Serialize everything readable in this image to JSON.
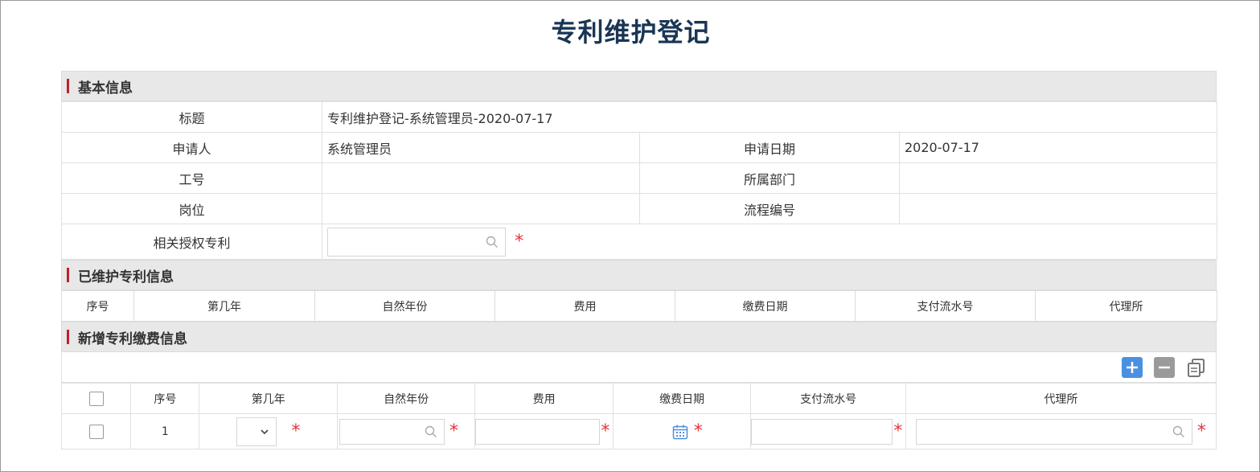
{
  "title": "专利维护登记",
  "sections": {
    "basic": "基本信息",
    "maintained": "已维护专利信息",
    "new_payment": "新增专利缴费信息"
  },
  "basic_info": {
    "title_label": "标题",
    "title_value": "专利维护登记-系统管理员-2020-07-17",
    "applicant_label": "申请人",
    "applicant_value": "系统管理员",
    "apply_date_label": "申请日期",
    "apply_date_value": "2020-07-17",
    "emp_no_label": "工号",
    "emp_no_value": "",
    "department_label": "所属部门",
    "department_value": "",
    "position_label": "岗位",
    "position_value": "",
    "flow_no_label": "流程编号",
    "flow_no_value": "",
    "patent_label": "相关授权专利",
    "patent_value": "",
    "required_mark": "*"
  },
  "maintained_columns": [
    "序号",
    "第几年",
    "自然年份",
    "费用",
    "缴费日期",
    "支付流水号",
    "代理所"
  ],
  "new_payment_columns": [
    "序号",
    "第几年",
    "自然年份",
    "费用",
    "缴费日期",
    "支付流水号",
    "代理所"
  ],
  "new_payment_rows": [
    {
      "index": "1",
      "year_no": "",
      "natural_year": "",
      "fee": "",
      "pay_date": "",
      "serial_no": "",
      "agency": ""
    }
  ],
  "icons": {
    "add": "plus-icon",
    "remove": "minus-icon",
    "copy": "copy-icon",
    "search": "search-icon",
    "calendar": "calendar-icon"
  },
  "colors": {
    "title": "#1a3554",
    "section_bar": "#c0202a",
    "required": "#e8333b",
    "add_button": "#4a90e2",
    "remove_button": "#9a9a9a",
    "calendar": "#4a90e2"
  }
}
